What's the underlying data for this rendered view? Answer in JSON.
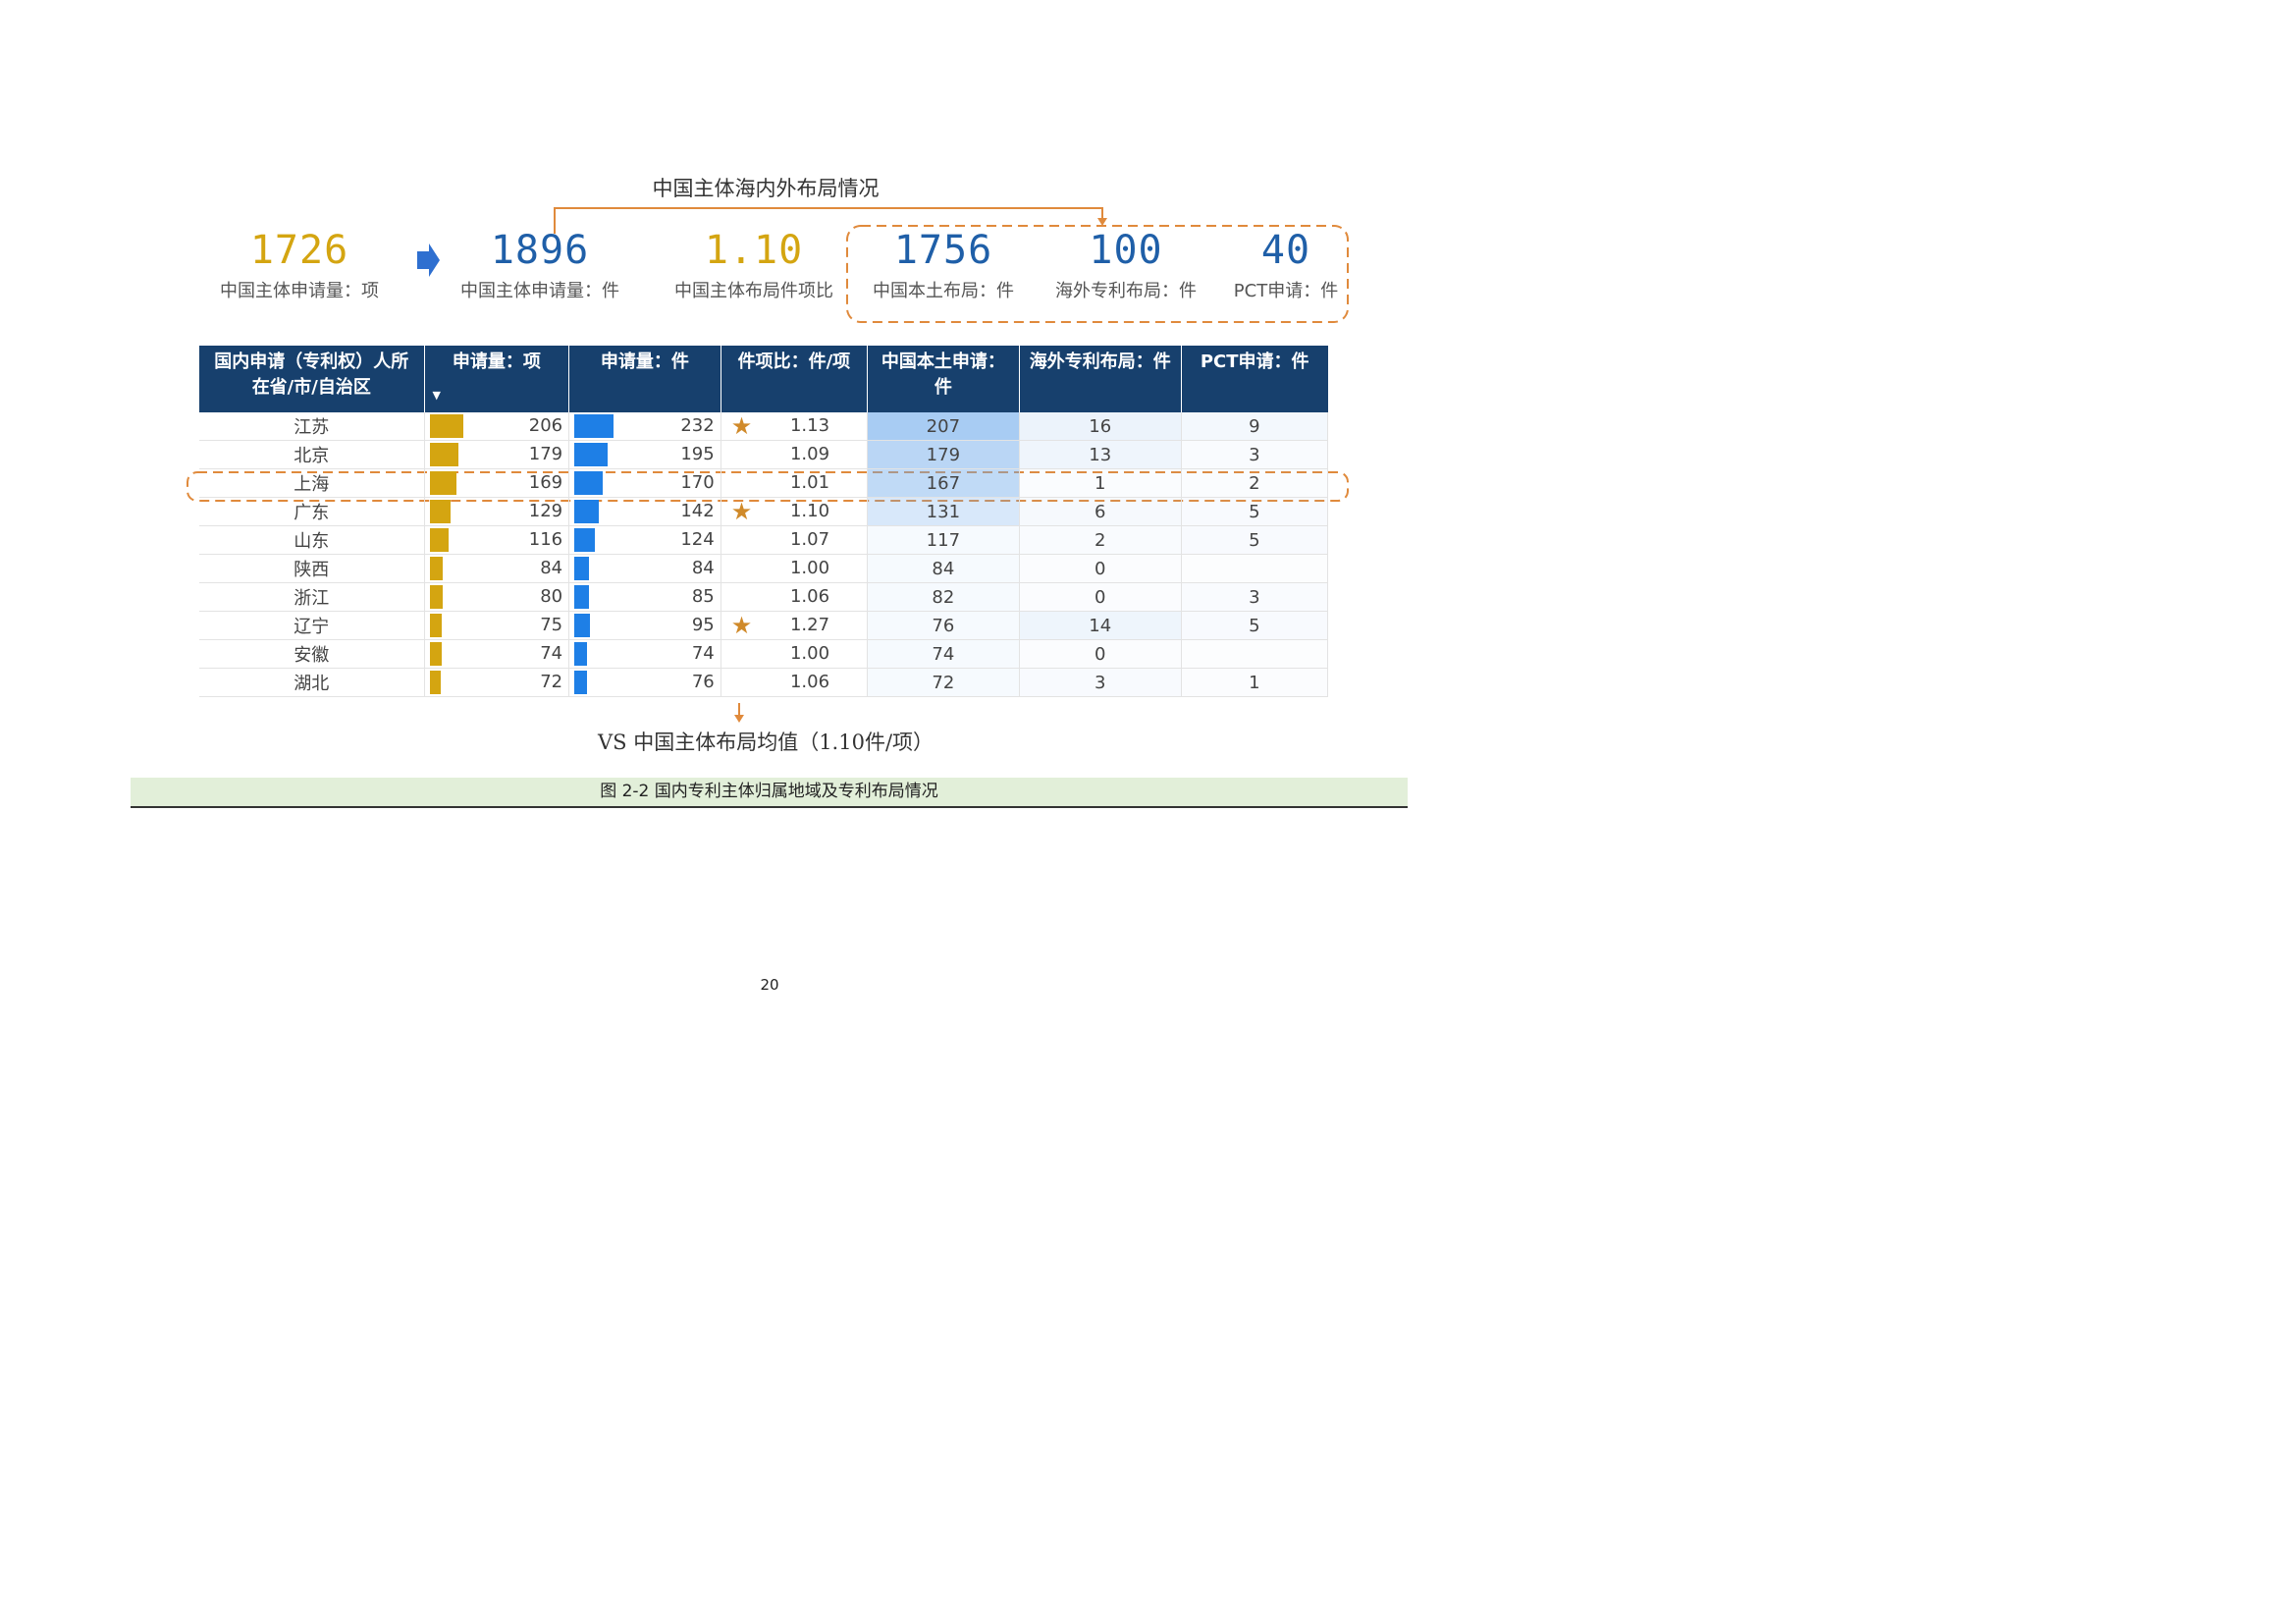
{
  "colors": {
    "gold": "#d4a511",
    "blue_bar": "#1e7fe6",
    "header_bg": "#17406d",
    "accent_orange": "#e08a3c"
  },
  "top_title": "中国主体海内外布局情况",
  "kpis": [
    {
      "value": "1726",
      "label": "中国主体申请量：项",
      "color": "gold"
    },
    {
      "value": "1896",
      "label": "中国主体申请量：件",
      "color": "blue"
    },
    {
      "value": "1.10",
      "label": "中国主体布局件项比",
      "color": "gold"
    },
    {
      "value": "1756",
      "label": "中国本土布局：件",
      "color": "blue"
    },
    {
      "value": "100",
      "label": "海外专利布局：件",
      "color": "blue"
    },
    {
      "value": "40",
      "label": "PCT申请：件",
      "color": "blue"
    }
  ],
  "table": {
    "headers": [
      "国内申请（专利权）人所在省/市/自治区",
      "申请量：项",
      "申请量：件",
      "件项比：件/项",
      "中国本土申请：件",
      "海外专利布局：件",
      "PCT申请：件"
    ],
    "rows": [
      {
        "prov": "江苏",
        "xiang": "206",
        "jian": "232",
        "ratio": "1.13",
        "star": true,
        "home": "207",
        "overseas": "16",
        "pct": "9"
      },
      {
        "prov": "北京",
        "xiang": "179",
        "jian": "195",
        "ratio": "1.09",
        "star": false,
        "home": "179",
        "overseas": "13",
        "pct": "3"
      },
      {
        "prov": "上海",
        "xiang": "169",
        "jian": "170",
        "ratio": "1.01",
        "star": false,
        "home": "167",
        "overseas": "1",
        "pct": "2"
      },
      {
        "prov": "广东",
        "xiang": "129",
        "jian": "142",
        "ratio": "1.10",
        "star": true,
        "home": "131",
        "overseas": "6",
        "pct": "5"
      },
      {
        "prov": "山东",
        "xiang": "116",
        "jian": "124",
        "ratio": "1.07",
        "star": false,
        "home": "117",
        "overseas": "2",
        "pct": "5"
      },
      {
        "prov": "陕西",
        "xiang": "84",
        "jian": "84",
        "ratio": "1.00",
        "star": false,
        "home": "84",
        "overseas": "0",
        "pct": ""
      },
      {
        "prov": "浙江",
        "xiang": "80",
        "jian": "85",
        "ratio": "1.06",
        "star": false,
        "home": "82",
        "overseas": "0",
        "pct": "3"
      },
      {
        "prov": "辽宁",
        "xiang": "75",
        "jian": "95",
        "ratio": "1.27",
        "star": true,
        "home": "76",
        "overseas": "14",
        "pct": "5"
      },
      {
        "prov": "安徽",
        "xiang": "74",
        "jian": "74",
        "ratio": "1.00",
        "star": false,
        "home": "74",
        "overseas": "0",
        "pct": ""
      },
      {
        "prov": "湖北",
        "xiang": "72",
        "jian": "76",
        "ratio": "1.06",
        "star": false,
        "home": "72",
        "overseas": "3",
        "pct": "1"
      }
    ]
  },
  "vs_text": "VS 中国主体布局均值（1.10件/项）",
  "caption": "图 2-2  国内专利主体归属地域及专利布局情况",
  "page_number": "20"
}
